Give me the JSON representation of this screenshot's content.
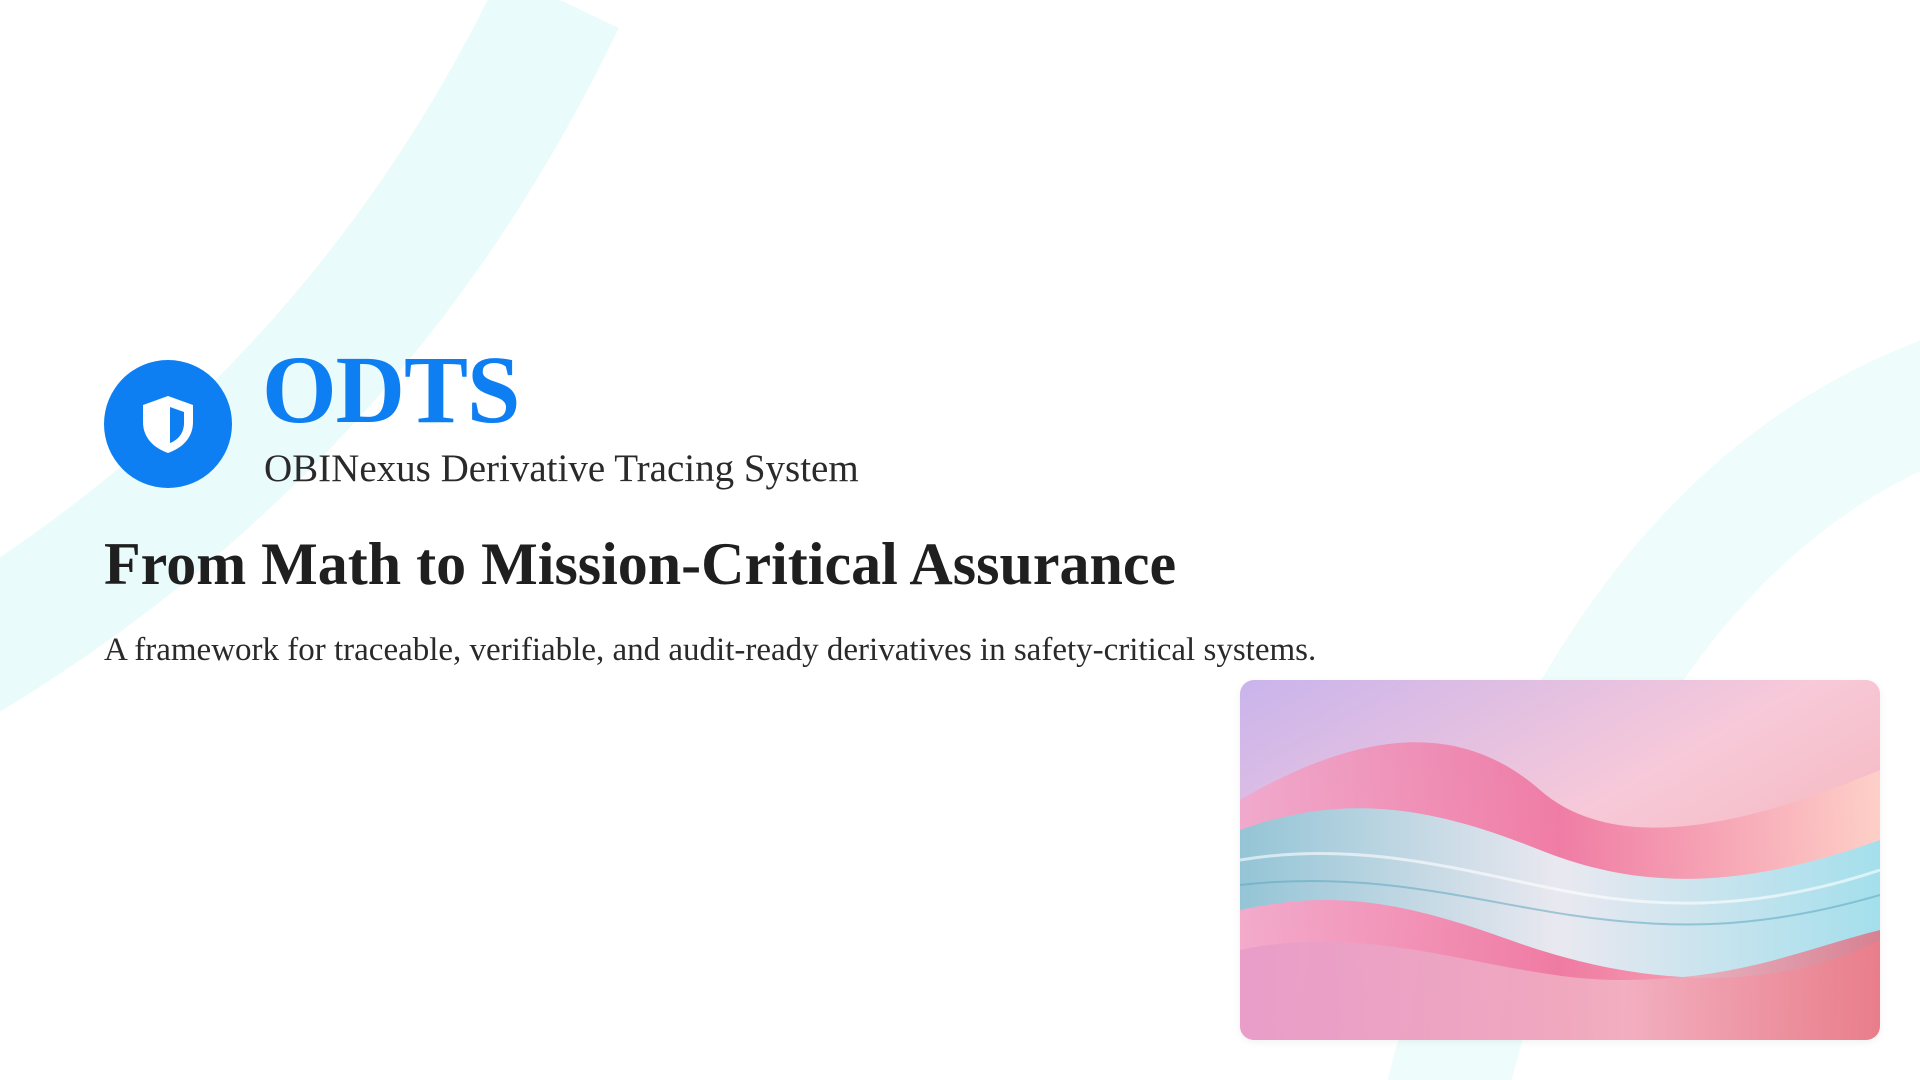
{
  "theme": {
    "accent": "#0d7ff2",
    "background_stripe": "#eafbfb"
  },
  "brand": {
    "logo_icon": "shield-icon",
    "title": "ODTS",
    "subtitle": "OBINexus Derivative Tracing System"
  },
  "hero": {
    "headline": "From Math to Mission-Critical Assurance",
    "tagline": "A framework for traceable, verifiable, and audit-ready derivatives in safety-critical systems."
  },
  "illustration": {
    "subject": "abstract-pastel-waves"
  }
}
